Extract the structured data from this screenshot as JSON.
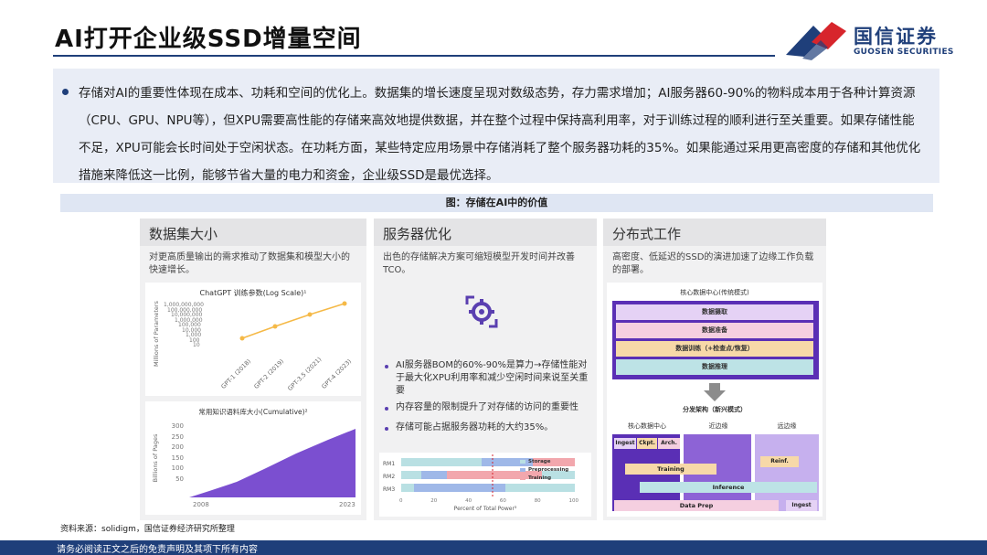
{
  "header": {
    "title": "AI打开企业级SSD增量空间",
    "logo_cn": "国信证券",
    "logo_en": "GUOSEN SECURITIES"
  },
  "summary": {
    "text": "存储对AI的重要性体现在成本、功耗和空间的优化上。数据集的增长速度呈现对数级态势，存力需求增加；AI服务器60-90%的物料成本用于各种计算资源（CPU、GPU、NPU等），但XPU需要高性能的存储来高效地提供数据，并在整个过程中保持高利用率，对于训练过程的顺利进行至关重要。如果存储性能不足，XPU可能会长时间处于空闲状态。在功耗方面，某些特定应用场景中存储消耗了整个服务器功耗的35%。如果能通过采用更高密度的存储和其他优化措施来降低这一比例，能够节省大量的电力和资金，企业级SSD是最优选择。"
  },
  "figure": {
    "title": "图：存储在AI中的价值",
    "panels": {
      "dataset": {
        "heading": "数据集大小",
        "desc": "对更高质量输出的需求推动了数据集和模型大小的快速增长。",
        "chart1_title": "ChatGPT 训练参数(Log Scale)¹",
        "chart1_ylabel": "Millions of Parameters",
        "chart1_yticks": [
          "1,000,000,000",
          "100,000,000",
          "10,000,000",
          "1,000,000",
          "100,000",
          "10,000",
          "1,000",
          "100",
          "10"
        ],
        "chart1_xticks": [
          "GPT-1 (2018)",
          "GPT-2 (2019)",
          "GPT-3.5 (2021)",
          "GPT-4 (2023)"
        ],
        "chart2_title": "常用知识语料库大小(Cumulative)²",
        "chart2_ylabel": "Billions of Pages",
        "chart2_yticks": [
          "300",
          "250",
          "200",
          "150",
          "100",
          "50"
        ],
        "chart2_x_start": "2008",
        "chart2_x_end": "2023"
      },
      "server": {
        "heading": "服务器优化",
        "desc": "出色的存储解决方案可缩短模型开发时间并改善TCO。",
        "bullets": [
          "AI服务器BOM的60%-90%是算力→存储性能对于最大化XPU利用率和减少空闲时间来说至关重要",
          "内存容量的限制提升了对存储的访问的重要性",
          "存储可能占据服务器功耗的大约35%。"
        ],
        "bar_rows": [
          "RM1",
          "RM2",
          "RM3"
        ],
        "bar_legend": [
          "Storage",
          "Preprocessing",
          "Training"
        ],
        "bar_xticks": [
          "0",
          "20",
          "40",
          "60",
          "80",
          "100"
        ],
        "bar_xlabel": "Percent of Total Power³"
      },
      "distributed": {
        "heading": "分布式工作",
        "desc": "高密度、低延迟的SSD的演进加速了边缘工作负载的部署。",
        "core_title": "核心数据中心(传统模式)",
        "core_steps": [
          "数据摄取",
          "数据准备",
          "数据训练（+检查点/恢复）",
          "数据推理"
        ],
        "dist_title": "分发架构（新兴模式）",
        "dist_cols": [
          "核心数据中心",
          "近边缘",
          "远边缘"
        ],
        "tiles": [
          "Ingest",
          "Ckpt.",
          "Arch.",
          "Training",
          "Reinf.",
          "Inference",
          "Data Prep",
          "Ingest"
        ]
      }
    }
  },
  "source": "资料来源：solidigm，国信证券经济研究所整理",
  "footer": "请务必阅读正文之后的免责声明及其项下所有内容",
  "colors": {
    "brand": "#1f3f7a",
    "accent_red": "#d7252c",
    "purple": "#7b4fd0"
  }
}
